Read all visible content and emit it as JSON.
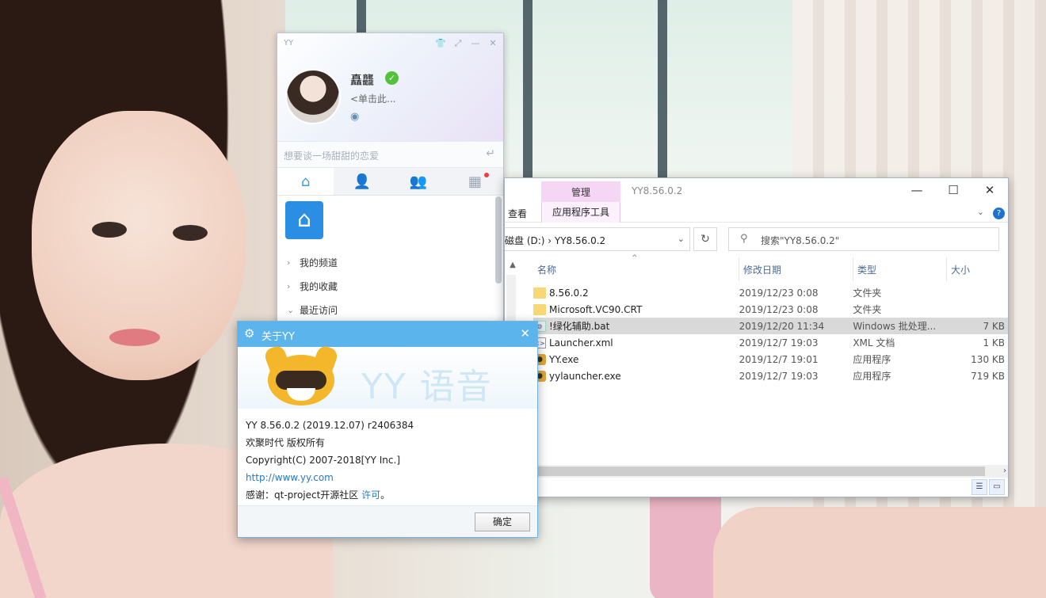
{
  "yy_panel": {
    "logo": "YY",
    "user_name": "矗龘",
    "signature": "<单击此...",
    "mood_placeholder": "想要谈一场甜甜的恋爱",
    "nav_items": [
      "我的频道",
      "我的收藏",
      "最近访问"
    ]
  },
  "explorer": {
    "context_tab": "管理",
    "title": "YY8.56.0.2",
    "ribbon_view": "查看",
    "ribbon_app_tools": "应用程序工具",
    "address_path": "磁盘 (D:)  ›  YY8.56.0.2",
    "search_placeholder": "搜索\"YY8.56.0.2\"",
    "columns": [
      "名称",
      "修改日期",
      "类型",
      "大小"
    ],
    "files": [
      {
        "name": "8.56.0.2",
        "date": "2019/12/23 0:08",
        "type": "文件夹",
        "size": "",
        "icon": "folder"
      },
      {
        "name": "Microsoft.VC90.CRT",
        "date": "2019/12/23 0:08",
        "type": "文件夹",
        "size": "",
        "icon": "folder"
      },
      {
        "name": "!绿化辅助.bat",
        "date": "2019/12/20 11:34",
        "type": "Windows 批处理...",
        "size": "7 KB",
        "icon": "bat"
      },
      {
        "name": "Launcher.xml",
        "date": "2019/12/7 19:03",
        "type": "XML 文档",
        "size": "1 KB",
        "icon": "xml"
      },
      {
        "name": "YY.exe",
        "date": "2019/12/7 19:01",
        "type": "应用程序",
        "size": "130 KB",
        "icon": "exe"
      },
      {
        "name": "yylauncher.exe",
        "date": "2019/12/7 19:03",
        "type": "应用程序",
        "size": "719 KB",
        "icon": "exe"
      }
    ],
    "selected_row": 2
  },
  "about": {
    "title": "关于YY",
    "brand_text": "YY 语音",
    "version": "YY 8.56.0.2 (2019.12.07) r2406384",
    "company": "欢聚时代 版权所有",
    "copyright": "Copyright(C) 2007-2018[YY Inc.]",
    "url": "http://www.yy.com",
    "thanks_prefix": "感谢：qt-project开源社区 ",
    "thanks_link": "许可",
    "thanks_suffix": "。",
    "ok_label": "确定"
  }
}
